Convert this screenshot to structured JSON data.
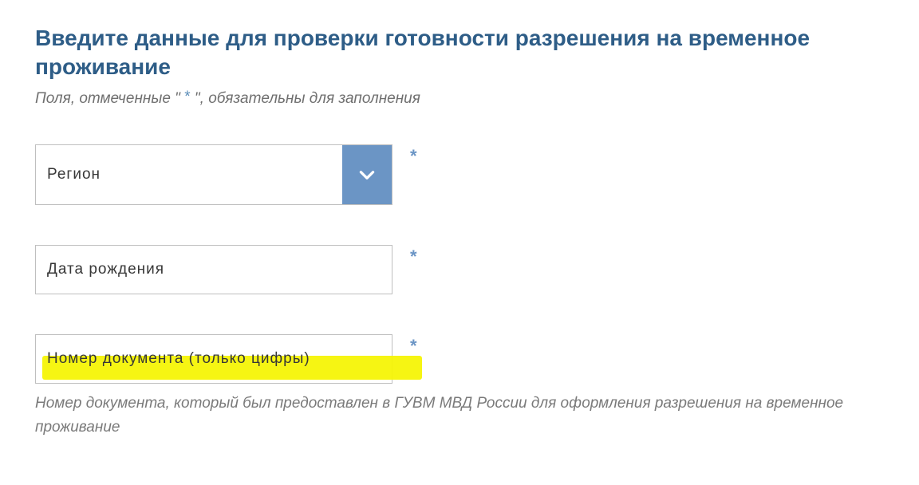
{
  "heading": "Введите данные для проверки готовности разрешения на временное проживание",
  "required_note_prefix": "Поля, отмеченные \" ",
  "required_note_star": "*",
  "required_note_suffix": " \", обязательны для заполнения",
  "fields": {
    "region": {
      "label": "Регион"
    },
    "dob": {
      "placeholder": "Дата рождения"
    },
    "docnum": {
      "placeholder": "Номер документа (только цифры)"
    }
  },
  "req_mark": "*",
  "helper": "Номер документа, который был предоставлен в ГУВМ МВД России для оформления разрешения на временное проживание"
}
